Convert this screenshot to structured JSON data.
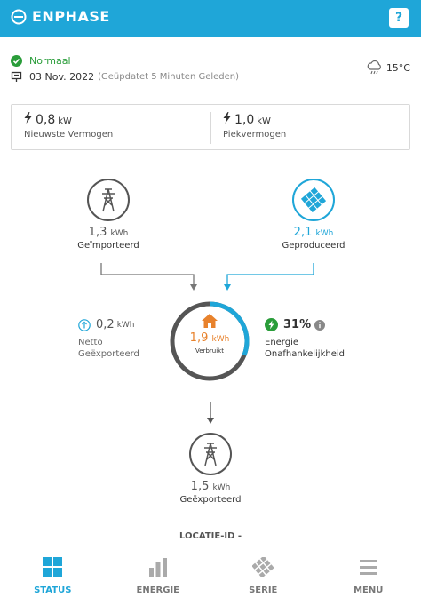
{
  "header": {
    "brand": "ENPHASE",
    "help_label": "?"
  },
  "status": {
    "text": "Normaal",
    "color": "#2a9d3a"
  },
  "date": {
    "text": "03 Nov. 2022",
    "sub": "(Geüpdatet 5 Minuten Geleden)"
  },
  "weather": {
    "temp": "15°C",
    "icon": "cloud-rain-icon"
  },
  "summary": {
    "latest": {
      "value": "0,8",
      "unit": "kW",
      "label": "Nieuwste Vermogen"
    },
    "peak": {
      "value": "1,0",
      "unit": "kW",
      "label": "Piekvermogen"
    }
  },
  "flow": {
    "imported": {
      "value": "1,3",
      "unit": "kWh",
      "label": "Geïmporteerd"
    },
    "produced": {
      "value": "2,1",
      "unit": "kWh",
      "label": "Geproduceerd"
    },
    "net_exported": {
      "value": "0,2",
      "unit": "kWh",
      "label_1": "Netto",
      "label_2": "Geëxporteerd"
    },
    "consumption": {
      "value": "1,9",
      "unit": "kWh",
      "label": "Verbruikt"
    },
    "independence": {
      "value": "31%",
      "label_1": "Energie",
      "label_2": "Onafhankelijkheid",
      "fraction": 0.31
    },
    "exported": {
      "value": "1,5",
      "unit": "kWh",
      "label": "Geëxporteerd"
    }
  },
  "location": {
    "label": "LOCATIE-ID -"
  },
  "nav": {
    "items": [
      {
        "label": "STATUS",
        "icon": "grid-icon"
      },
      {
        "label": "ENERGIE",
        "icon": "bar-chart-icon"
      },
      {
        "label": "SERIE",
        "icon": "solar-panel-icon"
      },
      {
        "label": "MENU",
        "icon": "hamburger-icon"
      }
    ]
  },
  "colors": {
    "brand": "#1fa6d8",
    "consumption": "#e8822c",
    "ok": "#2a9d3a",
    "grid": "#555555"
  }
}
